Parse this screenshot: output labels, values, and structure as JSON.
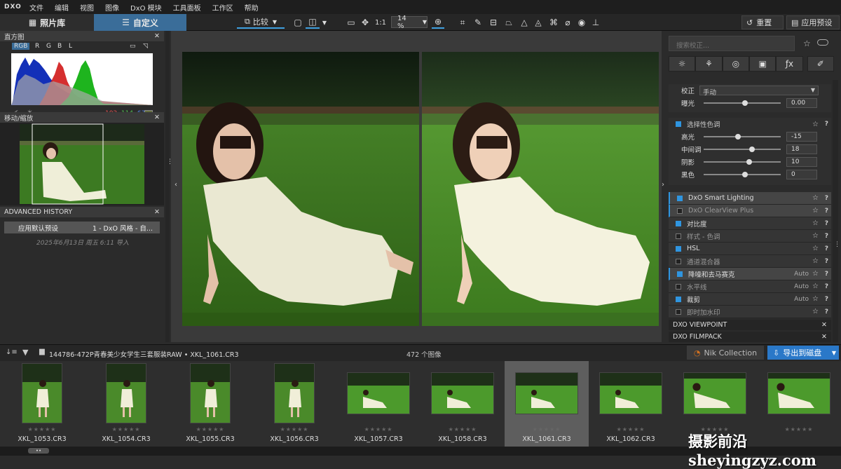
{
  "menu": {
    "logo": "DXO",
    "items": [
      "文件",
      "编辑",
      "视图",
      "图像",
      "DxO 模块",
      "工具面板",
      "工作区",
      "帮助"
    ]
  },
  "toolbar": {
    "library_tab": "照片库",
    "custom_tab": "自定义",
    "compare_label": "比较",
    "ratio_label": "1:1",
    "zoom": "14 %",
    "reset_label": "重置",
    "apply_preset_label": "应用预设"
  },
  "left": {
    "histogram_title": "直方图",
    "channels": [
      "RGB",
      "R",
      "G",
      "B",
      "L"
    ],
    "rgb_values": {
      "r": "102",
      "g": "114",
      "b": "63"
    },
    "nav_title": "移动/缩放",
    "history_title": "ADVANCED HISTORY",
    "history_item_label": "应用默认预设",
    "history_item_value": "1 - DxO 风格 - 自...",
    "history_date": "2025年6月13日 周五 6:11 导入"
  },
  "right": {
    "search_placeholder": "搜索校正...",
    "correction_label": "校正",
    "correction_value": "手动",
    "exposure_label": "曝光",
    "exposure_value": "0.00",
    "selective_title": "选择性色调",
    "tones": [
      {
        "label": "高光",
        "value": "-15",
        "pos": 0.41
      },
      {
        "label": "中间调",
        "value": "18",
        "pos": 0.59
      },
      {
        "label": "阴影",
        "value": "10",
        "pos": 0.55
      },
      {
        "label": "黑色",
        "value": "0",
        "pos": 0.5
      }
    ],
    "modules": [
      {
        "name": "DxO Smart Lighting",
        "on": true,
        "auto": "",
        "hl": true
      },
      {
        "name": "DxO ClearView Plus",
        "on": false,
        "auto": "",
        "hl": true
      },
      {
        "name": "对比度",
        "on": true,
        "auto": "",
        "hl": false
      },
      {
        "name": "样式 - 色调",
        "on": false,
        "auto": "",
        "hl": false
      },
      {
        "name": "HSL",
        "on": true,
        "auto": "",
        "hl": false
      },
      {
        "name": "通道混合器",
        "on": false,
        "auto": "",
        "hl": false
      },
      {
        "name": "降噪和去马赛克",
        "on": true,
        "auto": "Auto",
        "hl": true
      },
      {
        "name": "水平线",
        "on": false,
        "auto": "Auto",
        "hl": false
      },
      {
        "name": "裁剪",
        "on": true,
        "auto": "Auto",
        "hl": false
      },
      {
        "name": "即时加水印",
        "on": false,
        "auto": "",
        "hl": false
      }
    ],
    "viewpoint_label": "DXO VIEWPOINT",
    "filmpack_label": "DXO FILMPACK"
  },
  "film": {
    "path": "144786-472P青春美少女学生三套服装RAW",
    "current_file": "XKL_1061.CR3",
    "count_label": "472 个图像",
    "nik_label": "Nik Collection",
    "export_label": "导出到磁盘",
    "files": [
      "XKL_1053.CR3",
      "XKL_1054.CR3",
      "XKL_1055.CR3",
      "XKL_1056.CR3",
      "XKL_1057.CR3",
      "XKL_1058.CR3",
      "XKL_1061.CR3",
      "XKL_1062.CR3",
      "",
      ""
    ]
  },
  "watermark": "摄影前沿 sheyingzyz.com",
  "colors": {
    "accent": "#2f95e0",
    "active_tab": "#3a6d99"
  }
}
